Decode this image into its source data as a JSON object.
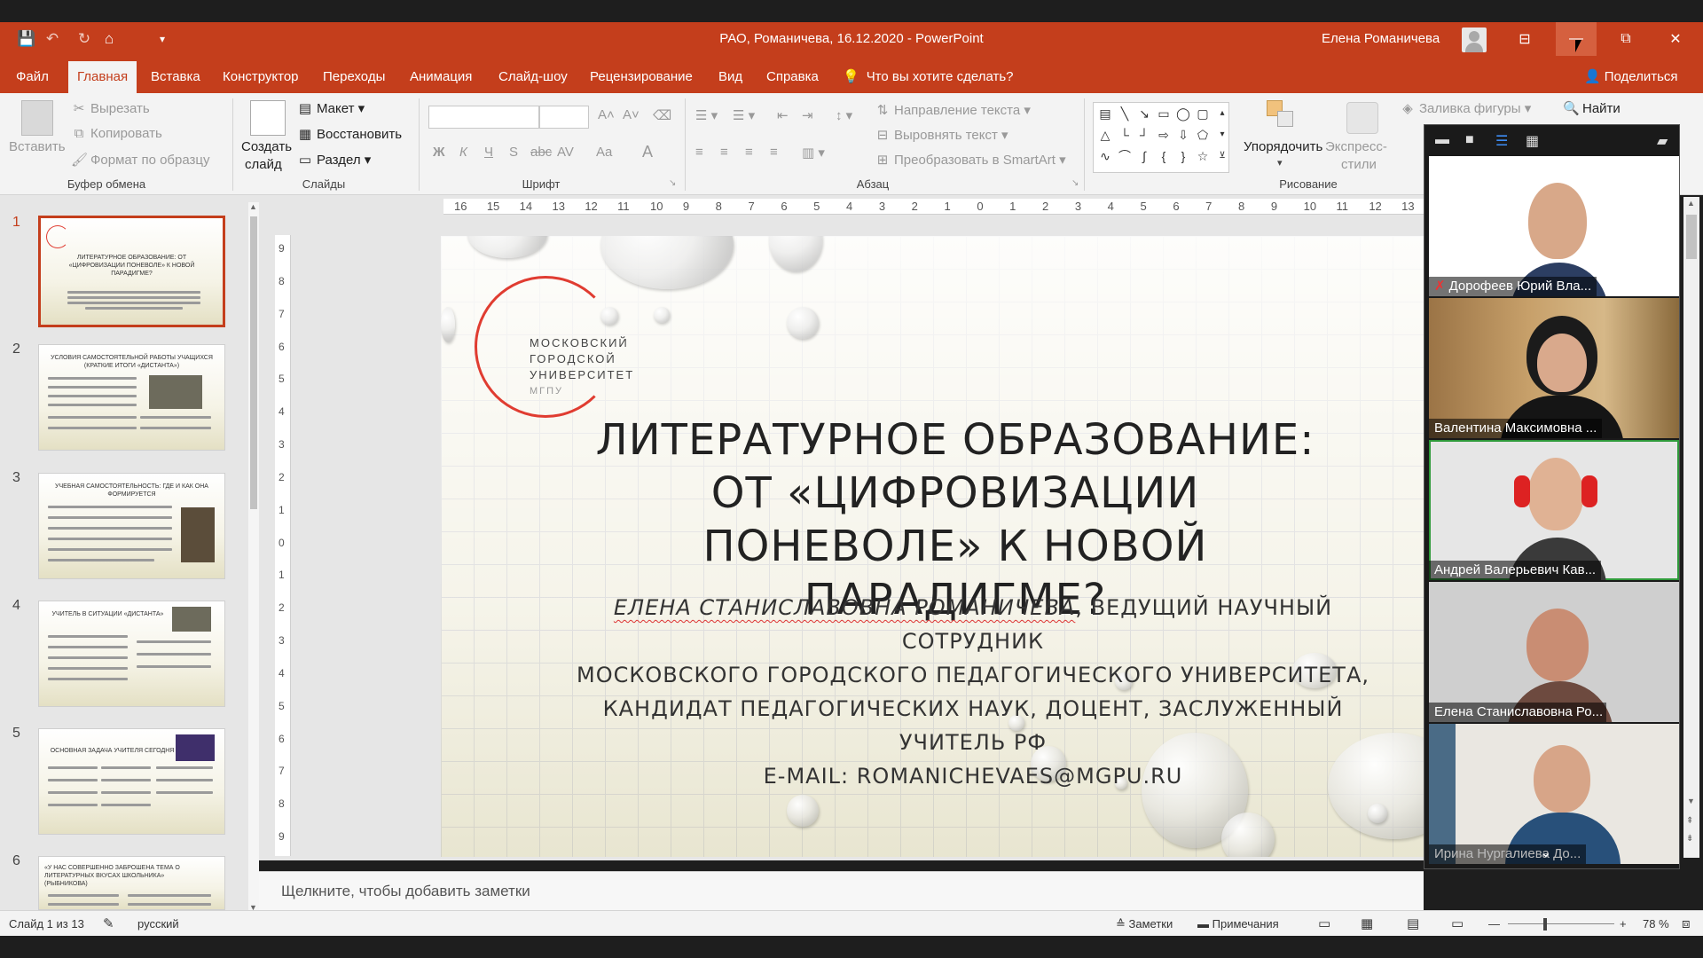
{
  "window": {
    "title": "РАО, Романичева, 16.12.2020  -  PowerPoint",
    "user_name": "Елена Романичева",
    "minimize": "—",
    "restore": "⧉",
    "close": "✕",
    "ribbon_display": "⊟"
  },
  "quick_access": {
    "save": "💾",
    "undo": "↶",
    "redo": "↻",
    "present": "⌂",
    "customize": "▾"
  },
  "menu": {
    "tabs": [
      "Файл",
      "Главная",
      "Вставка",
      "Конструктор",
      "Переходы",
      "Анимация",
      "Слайд-шоу",
      "Рецензирование",
      "Вид",
      "Справка"
    ],
    "active_tab": "Главная",
    "tell_me": "Что вы хотите сделать?",
    "share": "Поделиться"
  },
  "ribbon": {
    "clipboard": {
      "paste": "Вставить",
      "cut": "Вырезать",
      "copy": "Копировать",
      "format_painter": "Формат по образцу",
      "group_label": "Буфер обмена"
    },
    "slides": {
      "new_slide_line1": "Создать",
      "new_slide_line2": "слайд",
      "layout": "Макет",
      "reset": "Восстановить",
      "section": "Раздел",
      "group_label": "Слайды"
    },
    "font": {
      "group_label": "Шрифт",
      "bold": "Ж",
      "italic": "К",
      "underline": "Ч",
      "strike": "S",
      "abc": "abc",
      "spacing": "AV",
      "case": "Aa",
      "color": "A"
    },
    "paragraph": {
      "text_direction": "Направление текста",
      "align_text": "Выровнять текст",
      "smartart": "Преобразовать в SmartArt",
      "group_label": "Абзац"
    },
    "drawing": {
      "arrange": "Упорядочить",
      "quick_styles_line1": "Экспресс-",
      "quick_styles_line2": "стили",
      "shape_fill": "Заливка фигуры",
      "find": "Найти",
      "group_label": "Рисование"
    }
  },
  "thumbnails": [
    {
      "num": "1",
      "title": "ЛИТЕРАТУРНОЕ ОБРАЗОВАНИЕ: ОТ «ЦИФРОВИЗАЦИИ ПОНЕВОЛЕ» К НОВОЙ ПАРАДИГМЕ?"
    },
    {
      "num": "2",
      "title": "УСЛОВИЯ САМОСТОЯТЕЛЬНОЙ РАБОТЫ УЧАЩИХСЯ (КРАТКИЕ ИТОГИ «ДИСТАНТА»)"
    },
    {
      "num": "3",
      "title": "УЧЕБНАЯ САМОСТОЯТЕЛЬНОСТЬ: ГДЕ И КАК ОНА ФОРМИРУЕТСЯ"
    },
    {
      "num": "4",
      "title": "УЧИТЕЛЬ В СИТУАЦИИ «ДИСТАНТА»"
    },
    {
      "num": "5",
      "title": "ОСНОВНАЯ  ЗАДАЧА УЧИТЕЛЯ СЕГОДНЯ"
    },
    {
      "num": "6",
      "title": "«У НАС СОВЕРШЕННО ЗАБРОШЕНА ТЕМА О ЛИТЕРАТУРНЫХ ВКУСАХ ШКОЛЬНИКА» (РЫБНИКОВА)"
    }
  ],
  "ruler": {
    "h": [
      "16",
      "15",
      "14",
      "13",
      "12",
      "11",
      "10",
      "9",
      "8",
      "7",
      "6",
      "5",
      "4",
      "3",
      "2",
      "1",
      "0",
      "1",
      "2",
      "3",
      "4",
      "5",
      "6",
      "7",
      "8",
      "9",
      "10",
      "11",
      "12",
      "13"
    ],
    "v": [
      "9",
      "8",
      "7",
      "6",
      "5",
      "4",
      "3",
      "2",
      "1",
      "0",
      "1",
      "2",
      "3",
      "4",
      "5",
      "6",
      "7",
      "8",
      "9"
    ]
  },
  "slide": {
    "logo_line1": "МОСКОВСКИЙ",
    "logo_line2": "ГОРОДСКОЙ",
    "logo_line3": "УНИВЕРСИТЕТ",
    "logo_line4": "МГПУ",
    "title": "ЛИТЕРАТУРНОЕ ОБРАЗОВАНИЕ: ОТ «ЦИФРОВИЗАЦИИ ПОНЕВОЛЕ» К НОВОЙ ПАРАДИГМЕ?",
    "author": "ЕЛЕНА СТАНИСЛАВОВНА РОМАНИЧЕВА",
    "body_1": ", ВЕДУЩИЙ НАУЧНЫЙ СОТРУДНИК",
    "body_2": "МОСКОВСКОГО ГОРОДСКОГО ПЕДАГОГИЧЕСКОГО УНИВЕРСИТЕТА,",
    "body_3": "КАНДИДАТ ПЕДАГОГИЧЕСКИХ НАУК, ДОЦЕНТ, ЗАСЛУЖЕННЫЙ УЧИТЕЛЬ РФ",
    "body_4": "E-MAIL: ROMANICHEVAES@MGPU.RU"
  },
  "notes_placeholder": "Щелкните, чтобы добавить заметки",
  "status": {
    "slide_counter": "Слайд 1 из 13",
    "language": "русский",
    "notes": "Заметки",
    "comments": "Примечания",
    "zoom": "78 %"
  },
  "zoom_panel": {
    "participants": [
      {
        "name": "Дорофеев Юрий Вла...",
        "muted": true
      },
      {
        "name": "Валентина Максимовна ...",
        "muted": false
      },
      {
        "name": "Андрей Валерьевич Кав...",
        "muted": false
      },
      {
        "name": "Елена Станиславовна Ро...",
        "muted": false
      },
      {
        "name": "Ирина Нургалиева До...",
        "muted": false
      }
    ],
    "more": "⌄",
    "mute_icon": "✗"
  }
}
